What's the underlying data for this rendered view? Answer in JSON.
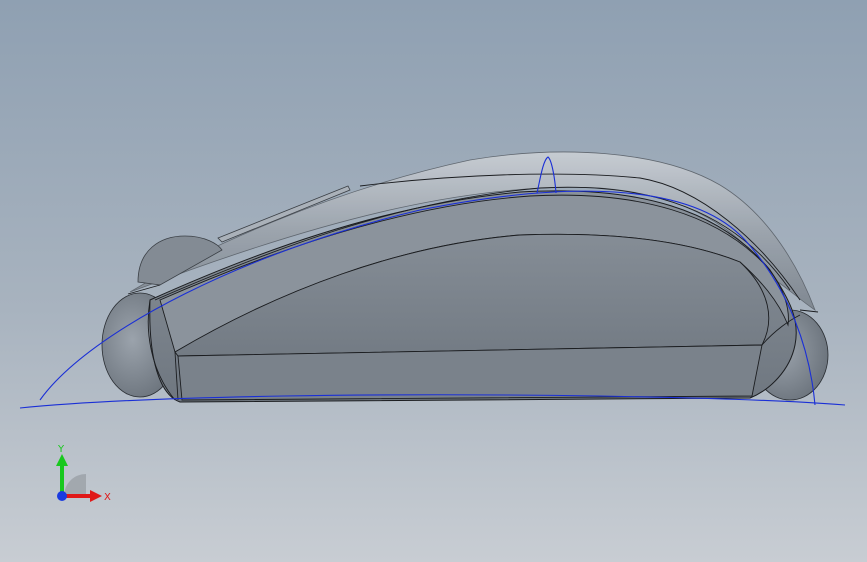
{
  "viewport": {
    "background_top": "#8fa0b2",
    "background_bottom": "#c8cdd3"
  },
  "model": {
    "body_color": "#7d858e",
    "shell_color": "#9aa2ab",
    "edge_color": "#1b1d20",
    "sketch_color": "#1a2fd6"
  },
  "triad": {
    "x_label": "X",
    "y_label": "Y",
    "x_color": "#e01818",
    "y_color": "#18c81e",
    "z_color": "#1a3ae0"
  }
}
